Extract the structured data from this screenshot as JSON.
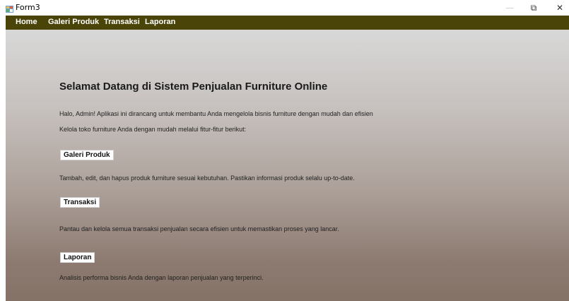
{
  "window": {
    "title": "Form3",
    "controls": {
      "minimize": "—",
      "restore": "⧉",
      "close": "✕"
    }
  },
  "menu": {
    "items": [
      {
        "label": "Home"
      },
      {
        "label": "Galeri Produk"
      },
      {
        "label": "Transaksi"
      },
      {
        "label": "Laporan"
      }
    ],
    "background_color": "#4a4408",
    "text_color": "#ffffff"
  },
  "main": {
    "heading": "Selamat Datang di Sistem Penjualan Furniture Online",
    "intro_1": "Halo, Admin! Aplikasi ini dirancang untuk membantu Anda mengelola bisnis furniture dengan mudah dan efisien",
    "intro_2": "Kelola toko furniture Anda dengan mudah melalui fitur-fitur berikut:",
    "sections": [
      {
        "label": "Galeri Produk",
        "description": "Tambah, edit, dan hapus produk furniture sesuai kebutuhan. Pastikan informasi produk selalu up-to-date."
      },
      {
        "label": "Transaksi",
        "description": "Pantau dan kelola semua transaksi penjualan secara efisien untuk memastikan proses yang lancar."
      },
      {
        "label": "Laporan",
        "description": "Analisis performa bisnis Anda dengan laporan penjualan yang terperinci."
      }
    ]
  },
  "icons": {
    "app_icon": "winforms-app-icon"
  }
}
